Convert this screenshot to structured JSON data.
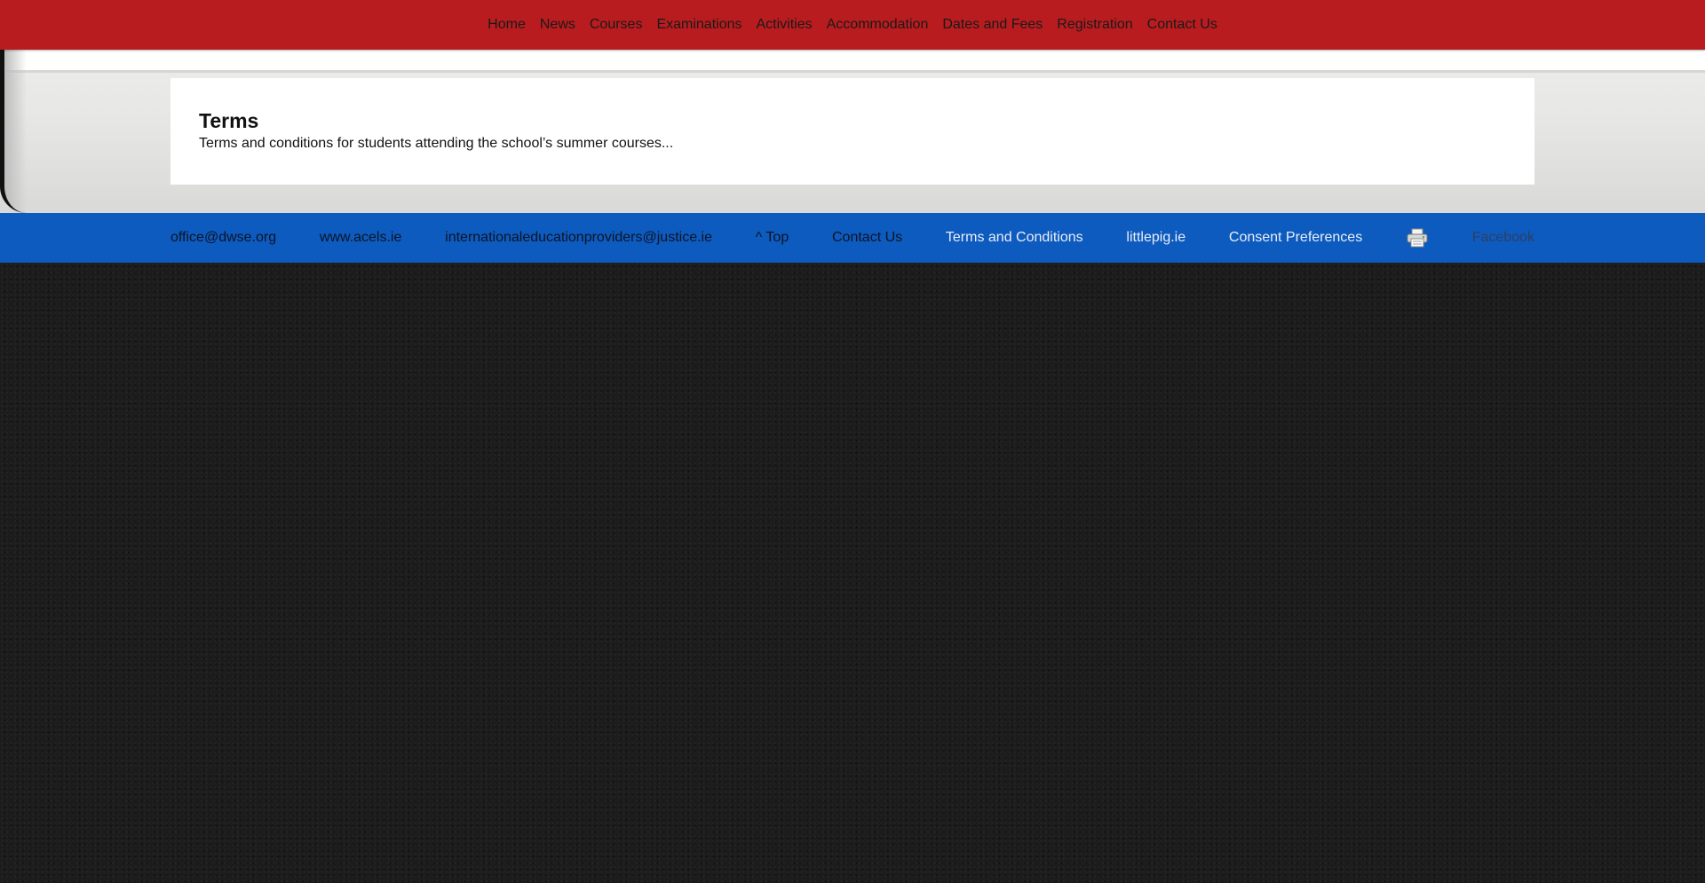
{
  "nav": {
    "items": [
      {
        "label": "Home"
      },
      {
        "label": "News"
      },
      {
        "label": "Courses"
      },
      {
        "label": "Examinations"
      },
      {
        "label": "Activities"
      },
      {
        "label": "Accommodation"
      },
      {
        "label": "Dates and Fees"
      },
      {
        "label": "Registration"
      },
      {
        "label": "Contact Us"
      }
    ]
  },
  "content": {
    "title": "Terms",
    "summary": "Terms and conditions for students attending the school’s summer courses..."
  },
  "footer": {
    "links": [
      {
        "label": "office@dwse.org"
      },
      {
        "label": "www.acels.ie"
      },
      {
        "label": "internationaleducationproviders@justice.ie"
      },
      {
        "label": "^ Top"
      },
      {
        "label": "Contact Us"
      },
      {
        "label": "Terms and Conditions"
      },
      {
        "label": "littlepig.ie"
      },
      {
        "label": "Consent Preferences"
      }
    ],
    "print_icon": "printer-icon",
    "facebook_label": "Facebook"
  },
  "colors": {
    "nav_background": "#b81c1f",
    "footer_background": "#0d5bbf",
    "page_background": "#1c1c1c"
  }
}
